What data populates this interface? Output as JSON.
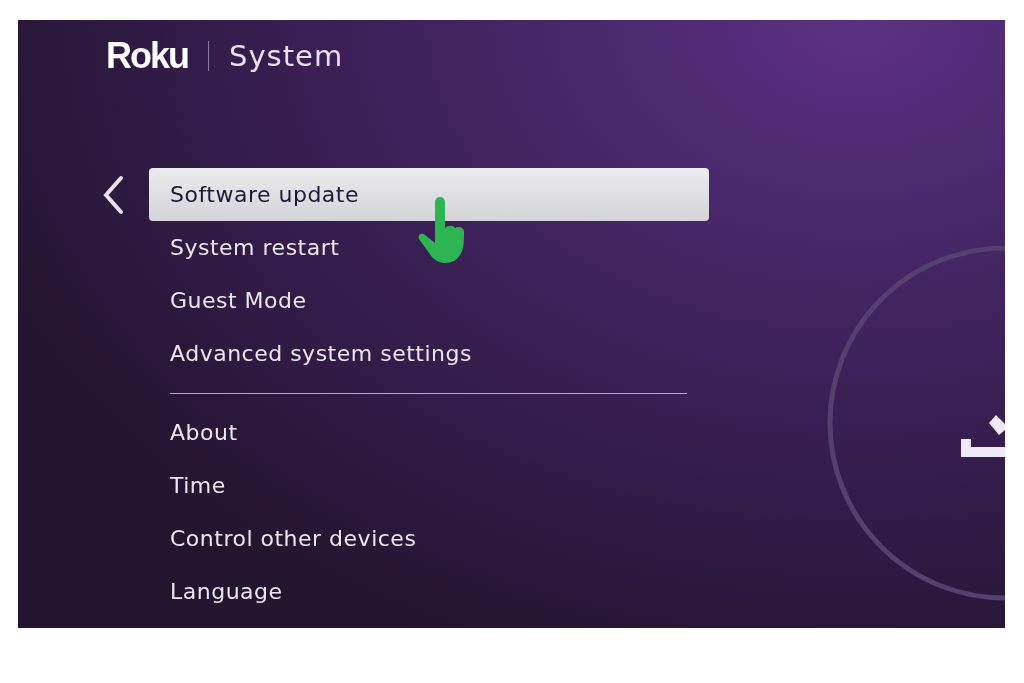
{
  "header": {
    "logo": "Roku",
    "title": "System"
  },
  "menu": {
    "sections": [
      {
        "items": [
          {
            "label": "Software update",
            "selected": true
          },
          {
            "label": "System restart",
            "selected": false
          },
          {
            "label": "Guest Mode",
            "selected": false
          },
          {
            "label": "Advanced system settings",
            "selected": false
          }
        ]
      },
      {
        "items": [
          {
            "label": "About",
            "selected": false
          },
          {
            "label": "Time",
            "selected": false
          },
          {
            "label": "Control other devices",
            "selected": false
          },
          {
            "label": "Language",
            "selected": false
          }
        ]
      }
    ]
  }
}
